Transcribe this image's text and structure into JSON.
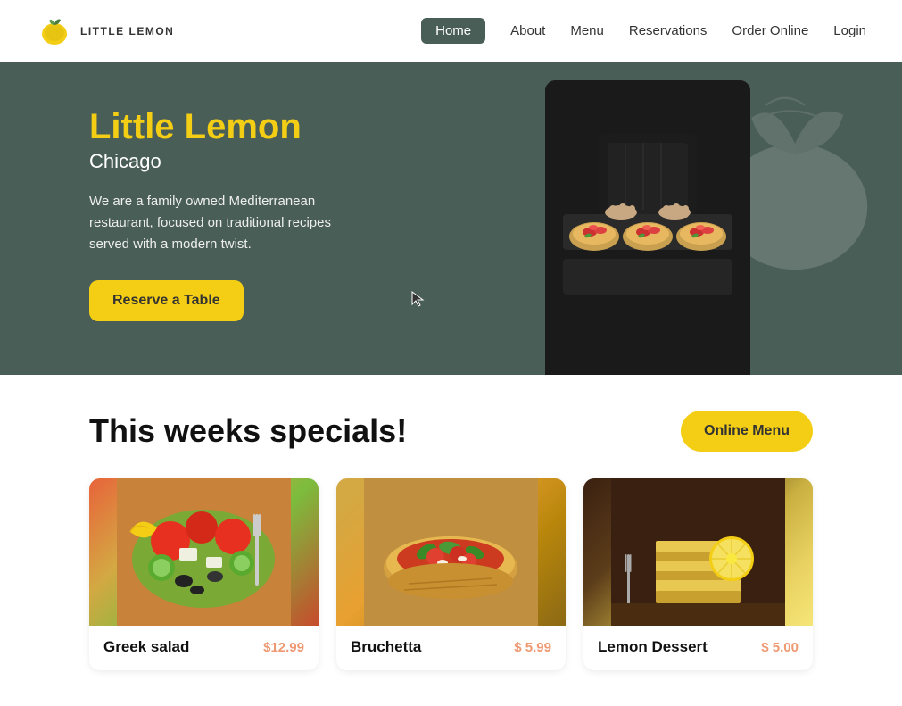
{
  "nav": {
    "logo_text": "LITTLE LEMON",
    "links": [
      {
        "id": "home",
        "label": "Home",
        "active": true
      },
      {
        "id": "about",
        "label": "About",
        "active": false
      },
      {
        "id": "menu",
        "label": "Menu",
        "active": false
      },
      {
        "id": "reservations",
        "label": "Reservations",
        "active": false
      },
      {
        "id": "order-online",
        "label": "Order Online",
        "active": false
      },
      {
        "id": "login",
        "label": "Login",
        "active": false
      }
    ]
  },
  "hero": {
    "title": "Little Lemon",
    "subtitle": "Chicago",
    "description": "We are a family owned Mediterranean restaurant, focused on traditional recipes served with a modern twist.",
    "cta_label": "Reserve a Table"
  },
  "specials": {
    "title": "This weeks specials!",
    "menu_button_label": "Online Menu",
    "cards": [
      {
        "id": "greek-salad",
        "name": "Greek salad",
        "price": "$12.99"
      },
      {
        "id": "bruchetta",
        "name": "Bruchetta",
        "price": "$ 5.99"
      },
      {
        "id": "lemon-dessert",
        "name": "Lemon Dessert",
        "price": "$ 5.00"
      }
    ]
  },
  "colors": {
    "accent_yellow": "#F4CE14",
    "dark_green": "#495E57",
    "price_orange": "#EE9972"
  }
}
